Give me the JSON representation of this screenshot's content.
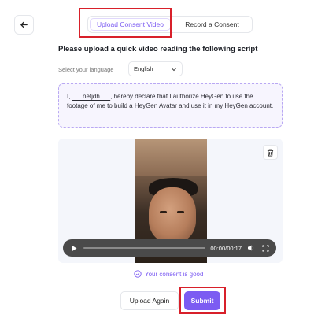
{
  "tabs": [
    {
      "label": "Upload Consent Video",
      "active": true
    },
    {
      "label": "Record a Consent",
      "active": false
    }
  ],
  "heading": "Please upload a quick video reading the following script",
  "language": {
    "label": "Select your language",
    "selected": "English"
  },
  "script": {
    "prefix": "I, ",
    "name": "      netjdh      ",
    "suffix": ", hereby declare that I authorize HeyGen to use the footage of me to build a HeyGen Avatar and use it in my HeyGen account."
  },
  "video": {
    "time": "00:00/00:17",
    "progress": 0.0
  },
  "status": {
    "message": "Your consent is good"
  },
  "actions": {
    "upload_again": "Upload Again",
    "submit": "Submit"
  },
  "colors": {
    "accent": "#7c5cf2",
    "highlight": "#d8202a"
  },
  "icons": {
    "back": "arrow-left-icon",
    "delete": "trash-icon",
    "play": "play-icon",
    "volume": "volume-icon",
    "fullscreen": "fullscreen-icon",
    "check": "check-circle-icon",
    "dropdown": "chevron-down-icon"
  }
}
